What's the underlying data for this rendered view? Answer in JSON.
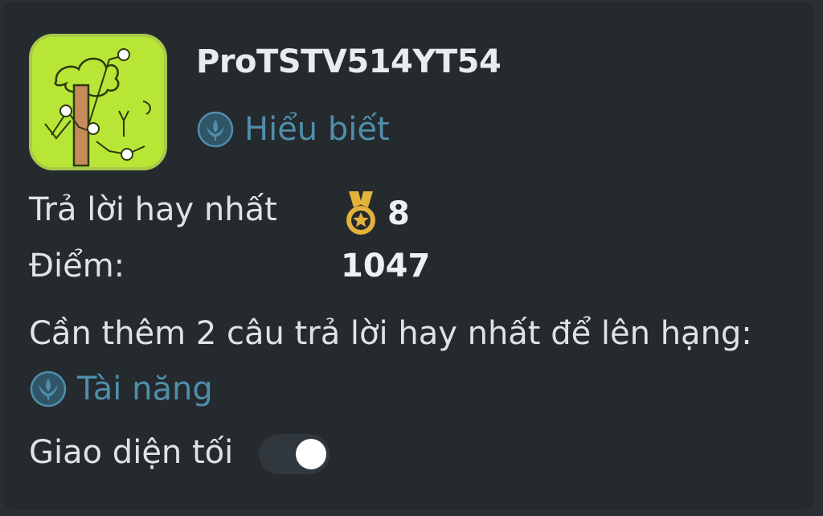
{
  "profile": {
    "username": "ProTSTV514YT54",
    "rank": "Hiểu biết",
    "rank_icon": "leaf-badge-icon"
  },
  "stats": {
    "best_answers_label": "Trả lời hay nhất",
    "best_answers_value": "8",
    "best_answers_icon": "medal-icon",
    "points_label": "Điểm:",
    "points_value": "1047"
  },
  "progress": {
    "message": "Cần thêm 2 câu trả lời hay nhất để lên hạng:",
    "next_rank": "Tài năng",
    "next_rank_icon": "leaf-badge-icon"
  },
  "settings": {
    "dark_mode_label": "Giao diện tối",
    "dark_mode_enabled": true
  },
  "colors": {
    "background": "#252a2e",
    "rank_text": "#4f8eab",
    "avatar_bg": "#b8e636",
    "medal": "#e2b23b"
  }
}
